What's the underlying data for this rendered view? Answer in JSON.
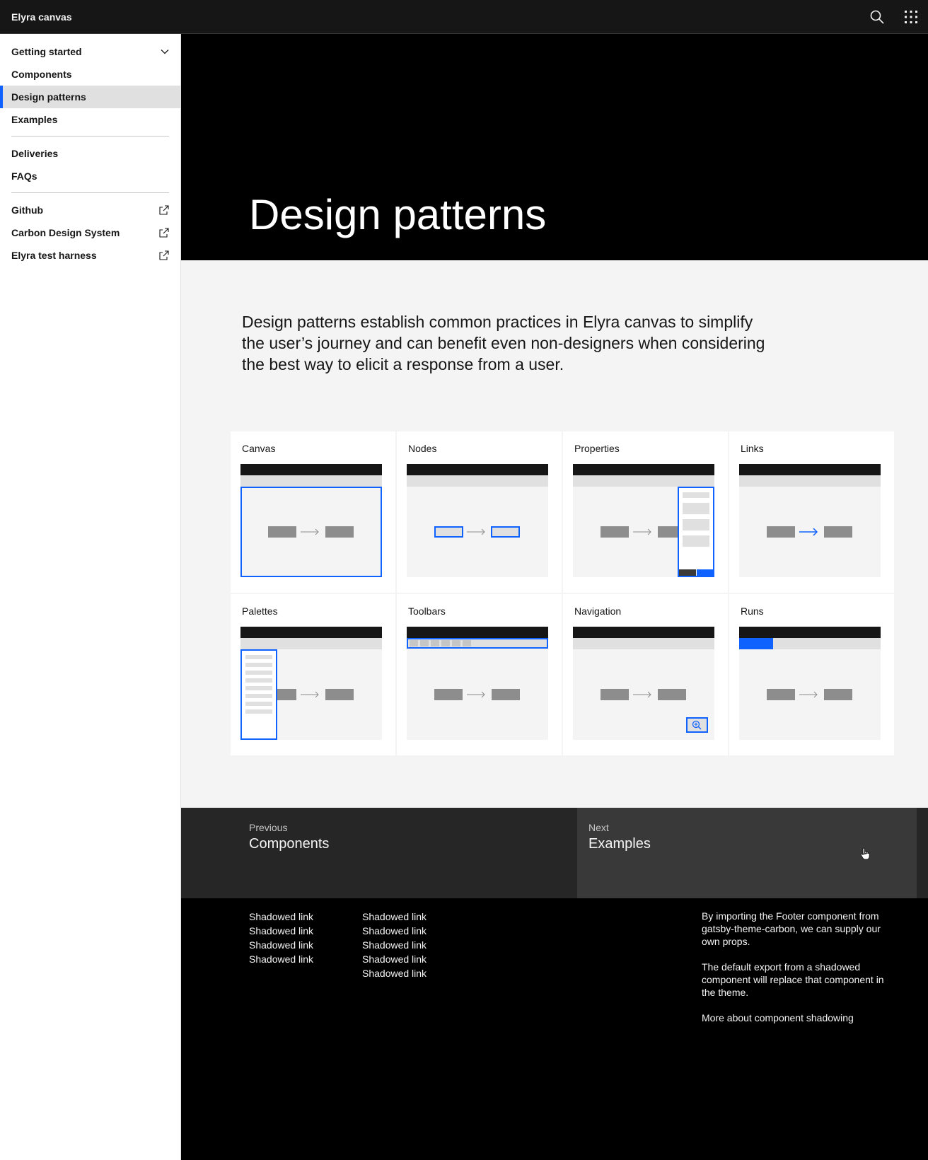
{
  "header": {
    "title": "Elyra canvas",
    "search_icon": "search-icon",
    "switcher_icon": "app-switcher-icon"
  },
  "sidebar": {
    "group1": [
      {
        "label": "Getting started",
        "icon": "chevron-down-icon"
      },
      {
        "label": "Components"
      },
      {
        "label": "Design patterns",
        "active": true
      },
      {
        "label": "Examples"
      }
    ],
    "group2": [
      {
        "label": "Deliveries"
      },
      {
        "label": "FAQs"
      }
    ],
    "group3": [
      {
        "label": "Github",
        "icon": "launch-icon"
      },
      {
        "label": "Carbon Design System",
        "icon": "launch-icon"
      },
      {
        "label": "Elyra test harness",
        "icon": "launch-icon"
      }
    ]
  },
  "hero": {
    "title": "Design patterns"
  },
  "intro": "Design patterns establish common practices in Elyra canvas to simplify the user’s journey and can benefit even non-designers when considering the best way to elicit a response from a user.",
  "tiles": [
    {
      "label": "Canvas"
    },
    {
      "label": "Nodes"
    },
    {
      "label": "Properties"
    },
    {
      "label": "Links"
    },
    {
      "label": "Palettes"
    },
    {
      "label": "Toolbars"
    },
    {
      "label": "Navigation"
    },
    {
      "label": "Runs"
    }
  ],
  "pager": {
    "prev_small": "Previous",
    "prev_big": "Components",
    "next_small": "Next",
    "next_big": "Examples"
  },
  "footer": {
    "col1": [
      "Shadowed link",
      "Shadowed link",
      "Shadowed link",
      "Shadowed link"
    ],
    "col2": [
      "Shadowed link",
      "Shadowed link",
      "Shadowed link",
      "Shadowed link",
      "Shadowed link"
    ],
    "info_p1": "By importing the Footer component from gatsby-theme-carbon, we can supply our own props.",
    "info_p2": "The default export from a shadowed component will replace that component in the theme.",
    "info_link": "More about component shadowing"
  },
  "colors": {
    "accent": "#0f62fe",
    "header_bg": "#161616",
    "hero_bg": "#000000",
    "content_bg": "#f4f4f4"
  }
}
